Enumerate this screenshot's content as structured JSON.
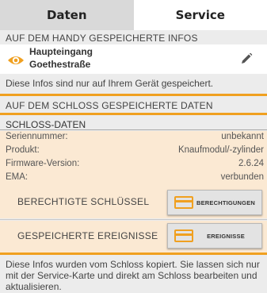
{
  "tabs": [
    {
      "label": "Daten",
      "active": false
    },
    {
      "label": "Service",
      "active": true
    }
  ],
  "stored_phone": {
    "header": "AUF DEM HANDY GESPEICHERTE INFOS",
    "location_name": "Haupteingang",
    "location_street": "Goethestraße",
    "location_icon": "eye-icon",
    "edit_icon": "pencil-icon",
    "note": "Diese Infos sind nur auf Ihrem Gerät gespeichert."
  },
  "stored_lock": {
    "header": "AUF DEM SCHLOSS GESPEICHERTE DATEN",
    "subheader": "SCHLOSS-DATEN",
    "rows": [
      {
        "label": "Seriennummer:",
        "value": "unbekannt"
      },
      {
        "label": "Produkt:",
        "value": "Knaufmodul/-zylinder"
      },
      {
        "label": "Firmware-Version:",
        "value": "2.6.24"
      },
      {
        "label": "EMA:",
        "value": "verbunden"
      }
    ]
  },
  "actions": [
    {
      "label": "BERECHTIGTE SCHLÜSSEL",
      "button": "BERECHTIGUNGEN",
      "icon": "card-icon"
    },
    {
      "label": "GESPEICHERTE EREIGNISSE",
      "button": "EREIGNISSE",
      "icon": "card-icon"
    }
  ],
  "footer": "Diese Infos wurden vom Schloss kopiert. Sie lassen sich nur mit der Service-Karte und direkt am Schloss bearbeiten und aktualisieren.",
  "colors": {
    "accent": "#f0a020",
    "highlight_bg": "#fbe9d3",
    "page_bg": "#ececec"
  }
}
